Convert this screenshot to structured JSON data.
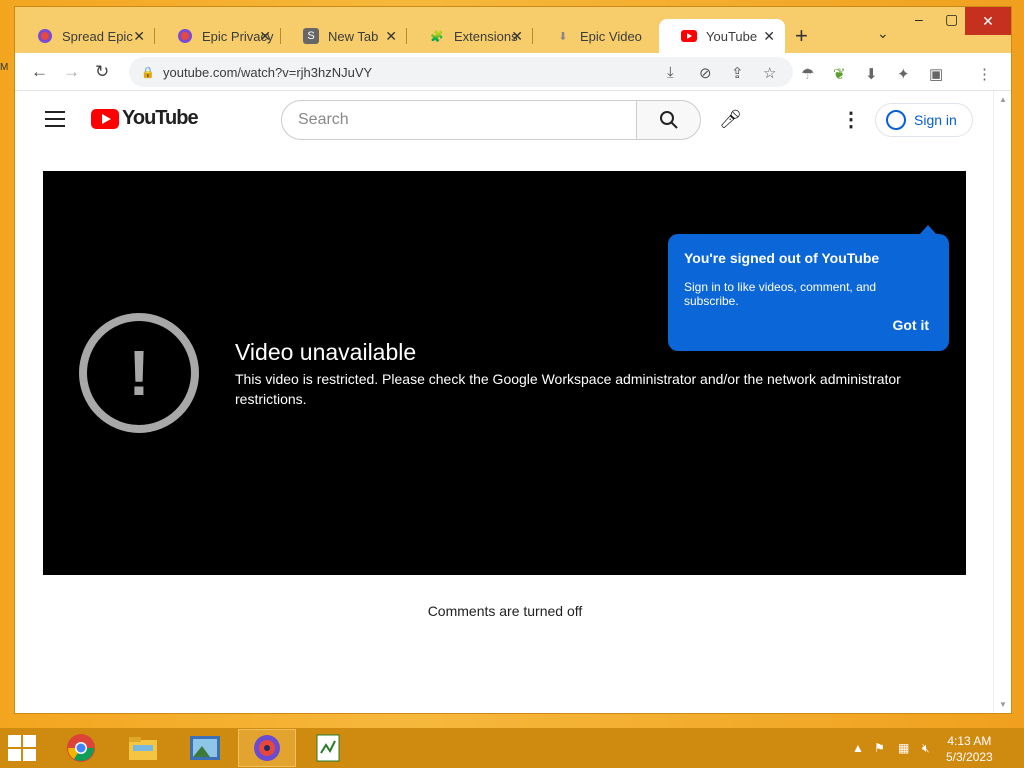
{
  "browser": {
    "tabs": [
      {
        "label": "Spread Epic",
        "icon": "epic-logo-icon"
      },
      {
        "label": "Epic Privacy",
        "icon": "epic-logo-icon"
      },
      {
        "label": "New Tab",
        "icon": "s-icon"
      },
      {
        "label": "Extensions",
        "icon": "puzzle-icon"
      },
      {
        "label": "Epic Video",
        "icon": "download-icon"
      },
      {
        "label": "YouTube",
        "icon": "youtube-icon"
      }
    ],
    "active_tab": 5,
    "url": "youtube.com/watch?v=rjh3hzNJuVY"
  },
  "youtube": {
    "search_placeholder": "Search",
    "sign_in_label": "Sign in",
    "video_title": "Video unavailable",
    "video_message": "This video is restricted. Please check the Google Workspace administrator and/or the network administrator restrictions.",
    "comments_text": "Comments are turned off",
    "popup": {
      "title": "You're signed out of YouTube",
      "message": "Sign in to like videos, comment, and subscribe.",
      "button": "Got it"
    },
    "logo_text": "YouTube"
  },
  "taskbar": {
    "time": "4:13 AM",
    "date": "5/3/2023"
  },
  "colors": {
    "popup_bg": "#0b66d8",
    "youtube_red": "#ff0000",
    "link_blue": "#065fd4"
  }
}
